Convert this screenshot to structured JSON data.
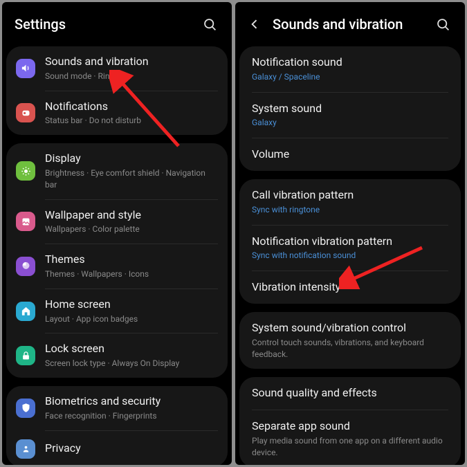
{
  "left": {
    "title": "Settings",
    "groups": [
      {
        "items": [
          {
            "icon": "speaker-icon",
            "color": "#7b68ee",
            "title": "Sounds and vibration",
            "sub": "Sound mode  ·  Ringtone"
          },
          {
            "icon": "bell-icon",
            "color": "#d9534f",
            "title": "Notifications",
            "sub": "Status bar  ·  Do not disturb"
          }
        ]
      },
      {
        "items": [
          {
            "icon": "sun-icon",
            "color": "#6fbf3e",
            "title": "Display",
            "sub": "Brightness  ·  Eye comfort shield  ·  Navigation bar"
          },
          {
            "icon": "wallpaper-icon",
            "color": "#d95a8c",
            "title": "Wallpaper and style",
            "sub": "Wallpapers  ·  Color palette"
          },
          {
            "icon": "themes-icon",
            "color": "#8a4fd1",
            "title": "Themes",
            "sub": "Themes  ·  Wallpapers  ·  Icons"
          },
          {
            "icon": "home-icon",
            "color": "#2aa9d1",
            "title": "Home screen",
            "sub": "Layout  ·  App icon badges"
          },
          {
            "icon": "lock-icon",
            "color": "#1fb587",
            "title": "Lock screen",
            "sub": "Screen lock type  ·  Always On Display"
          }
        ]
      },
      {
        "items": [
          {
            "icon": "shield-icon",
            "color": "#4a6fd1",
            "title": "Biometrics and security",
            "sub": "Face recognition  ·  Fingerprints"
          },
          {
            "icon": "privacy-icon",
            "color": "#5a8fd1",
            "title": "Privacy",
            "sub": ""
          }
        ]
      }
    ]
  },
  "right": {
    "title": "Sounds and vibration",
    "groups": [
      {
        "items": [
          {
            "title": "Notification sound",
            "sub": "Galaxy / Spaceline",
            "link": true
          },
          {
            "title": "System sound",
            "sub": "Galaxy",
            "link": true
          },
          {
            "title": "Volume",
            "sub": ""
          }
        ]
      },
      {
        "items": [
          {
            "title": "Call vibration pattern",
            "sub": "Sync with ringtone",
            "link": true
          },
          {
            "title": "Notification vibration pattern",
            "sub": "Sync with notification sound",
            "link": true
          },
          {
            "title": "Vibration intensity",
            "sub": ""
          }
        ]
      },
      {
        "items": [
          {
            "title": "System sound/vibration control",
            "sub": "Control touch sounds, vibrations, and keyboard feedback."
          }
        ]
      },
      {
        "items": [
          {
            "title": "Sound quality and effects",
            "sub": ""
          },
          {
            "title": "Separate app sound",
            "sub": "Play media sound from one app on a different audio device."
          }
        ]
      }
    ]
  }
}
